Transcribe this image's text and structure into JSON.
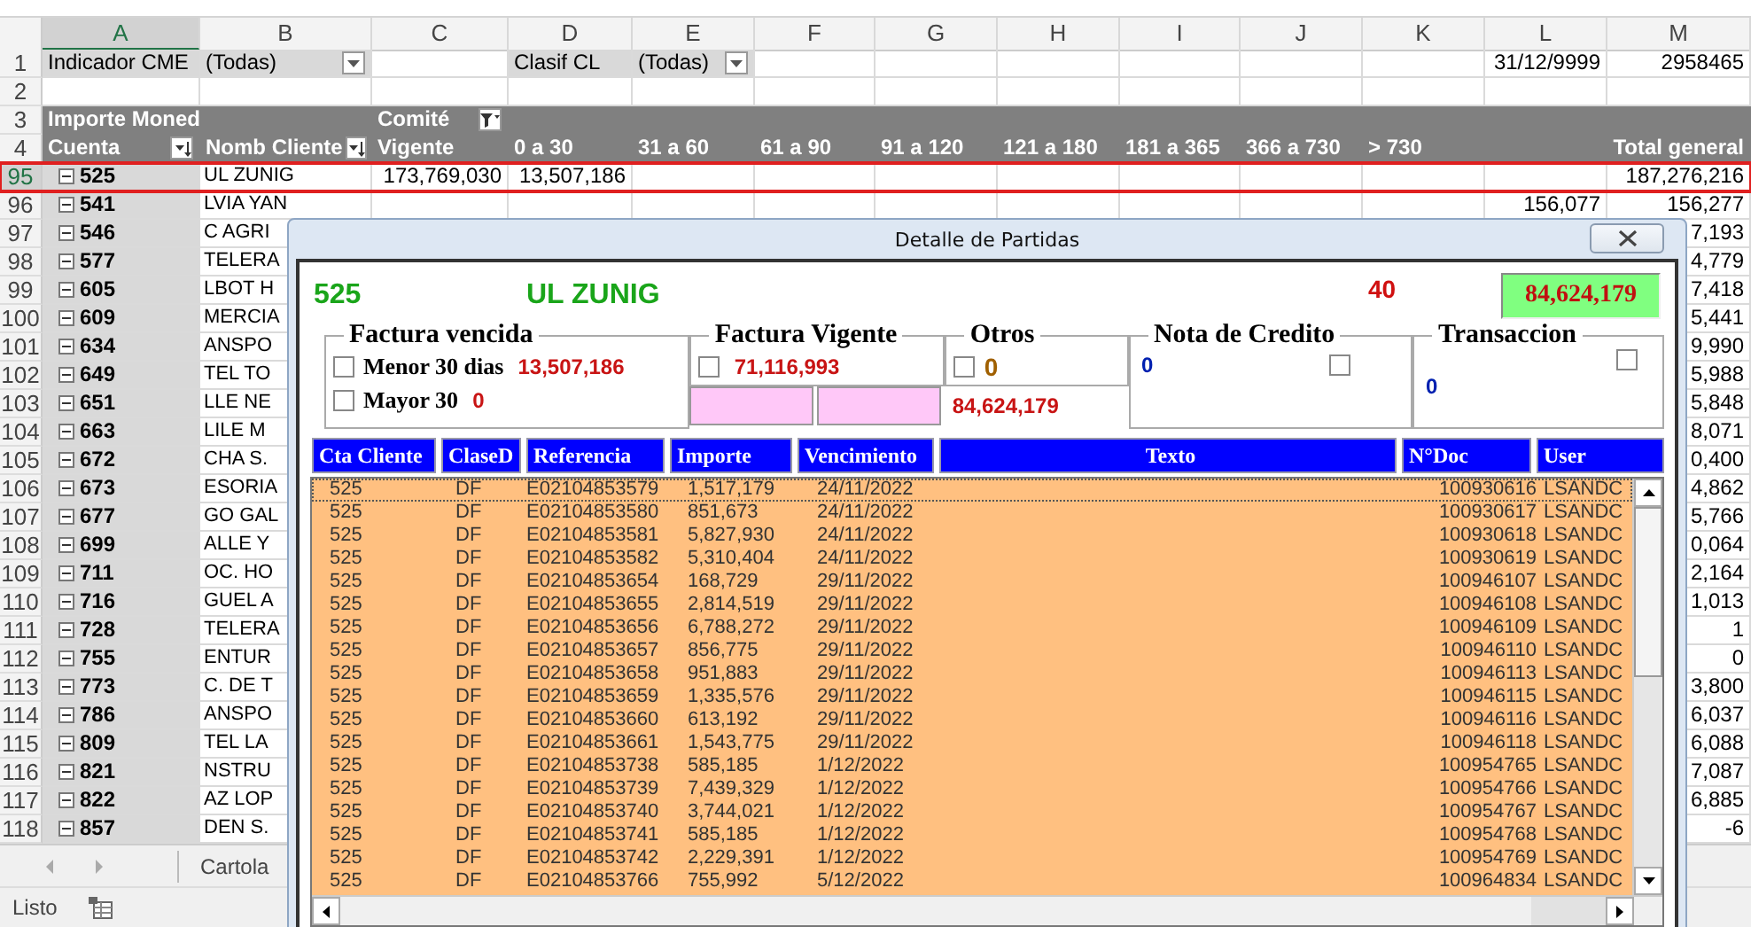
{
  "sheet": {
    "columns": [
      "A",
      "B",
      "C",
      "D",
      "E",
      "F",
      "G",
      "H",
      "I",
      "J",
      "K",
      "L",
      "M"
    ],
    "rows": [
      {
        "num": "1",
        "kind": "filter",
        "selected": false,
        "cells": {
          "A": {
            "text": "Indicador CME",
            "shaded": true
          },
          "B": {
            "text": "(Todas)",
            "shaded": true,
            "kind": "dropdown"
          },
          "D": {
            "text": "Clasif CL",
            "shaded": true
          },
          "E": {
            "text": "(Todas)",
            "shaded": true,
            "kind": "dropdown"
          },
          "L": {
            "text": "31/12/9999",
            "shaded": false
          },
          "M": {
            "text": "2958465",
            "shaded": false
          }
        }
      },
      {
        "num": "2",
        "kind": "blank",
        "selected": false
      },
      {
        "num": "3",
        "kind": "header",
        "selected": false,
        "cells": {
          "A": {
            "text": "Importe Moned"
          },
          "C": {
            "text": "Comité",
            "kind": "filter"
          }
        }
      },
      {
        "num": "4",
        "kind": "header",
        "selected": false,
        "cells": {
          "A": {
            "text": "Cuenta",
            "kind": "sort"
          },
          "B": {
            "text": "Nomb Cliente",
            "kind": "sort"
          },
          "C": {
            "text": "Vigente"
          },
          "D": {
            "text": "0 a 30"
          },
          "E": {
            "text": "31 a 60"
          },
          "F": {
            "text": "61 a 90"
          },
          "G": {
            "text": "91 a 120"
          },
          "H": {
            "text": "121 a 180"
          },
          "I": {
            "text": "181 a 365"
          },
          "J": {
            "text": "366 a 730"
          },
          "K": {
            "text": "> 730"
          },
          "M": {
            "text": "Total general"
          }
        }
      },
      {
        "num": "95",
        "kind": "data",
        "selected": true,
        "cells": {
          "A": {
            "text": "525"
          },
          "B": {
            "text": "UL ZUNIG"
          },
          "C": {
            "text": "173,769,030"
          },
          "D": {
            "text": "13,507,186"
          },
          "M": {
            "text": "187,276,216"
          }
        }
      },
      {
        "num": "96",
        "kind": "data",
        "selected": false,
        "cells": {
          "A": {
            "text": "541"
          },
          "B": {
            "text": "LVIA YAN"
          },
          "L": {
            "text": "156,077"
          },
          "M": {
            "text": "156,277"
          }
        }
      },
      {
        "num": "97",
        "kind": "data",
        "selected": false,
        "cells": {
          "A": {
            "text": "546"
          },
          "B": {
            "text": "C AGRI"
          },
          "M": {
            "text": "7,193"
          }
        }
      },
      {
        "num": "98",
        "kind": "data",
        "selected": false,
        "cells": {
          "A": {
            "text": "577"
          },
          "B": {
            "text": "TELERA"
          },
          "M": {
            "text": "4,779"
          }
        }
      },
      {
        "num": "99",
        "kind": "data",
        "selected": false,
        "cells": {
          "A": {
            "text": "605"
          },
          "B": {
            "text": "LBOT H"
          },
          "M": {
            "text": "7,418"
          }
        }
      },
      {
        "num": "100",
        "kind": "data",
        "selected": false,
        "cells": {
          "A": {
            "text": "609"
          },
          "B": {
            "text": "MERCIA"
          },
          "M": {
            "text": "5,441"
          }
        }
      },
      {
        "num": "101",
        "kind": "data",
        "selected": false,
        "cells": {
          "A": {
            "text": "634"
          },
          "B": {
            "text": "ANSPO"
          },
          "M": {
            "text": "9,990"
          }
        }
      },
      {
        "num": "102",
        "kind": "data",
        "selected": false,
        "cells": {
          "A": {
            "text": "649"
          },
          "B": {
            "text": "TEL TO"
          },
          "M": {
            "text": "5,988"
          }
        }
      },
      {
        "num": "103",
        "kind": "data",
        "selected": false,
        "cells": {
          "A": {
            "text": "651"
          },
          "B": {
            "text": "LLE NE"
          },
          "M": {
            "text": "5,848"
          }
        }
      },
      {
        "num": "104",
        "kind": "data",
        "selected": false,
        "cells": {
          "A": {
            "text": "663"
          },
          "B": {
            "text": "LILE M"
          },
          "M": {
            "text": "8,071"
          }
        }
      },
      {
        "num": "105",
        "kind": "data",
        "selected": false,
        "cells": {
          "A": {
            "text": "672"
          },
          "B": {
            "text": "CHA S."
          },
          "M": {
            "text": "0,400"
          }
        }
      },
      {
        "num": "106",
        "kind": "data",
        "selected": false,
        "cells": {
          "A": {
            "text": "673"
          },
          "B": {
            "text": "ESORIA"
          },
          "M": {
            "text": "4,862"
          }
        }
      },
      {
        "num": "107",
        "kind": "data",
        "selected": false,
        "cells": {
          "A": {
            "text": "677"
          },
          "B": {
            "text": "GO GAL"
          },
          "M": {
            "text": "5,766"
          }
        }
      },
      {
        "num": "108",
        "kind": "data",
        "selected": false,
        "cells": {
          "A": {
            "text": "699"
          },
          "B": {
            "text": "ALLE Y"
          },
          "M": {
            "text": "0,064"
          }
        }
      },
      {
        "num": "109",
        "kind": "data",
        "selected": false,
        "cells": {
          "A": {
            "text": "711"
          },
          "B": {
            "text": "OC. HO"
          },
          "M": {
            "text": "2,164"
          }
        }
      },
      {
        "num": "110",
        "kind": "data",
        "selected": false,
        "cells": {
          "A": {
            "text": "716"
          },
          "B": {
            "text": "GUEL A"
          },
          "M": {
            "text": "1,013"
          }
        }
      },
      {
        "num": "111",
        "kind": "data",
        "selected": false,
        "cells": {
          "A": {
            "text": "728"
          },
          "B": {
            "text": "TELERA"
          },
          "M": {
            "text": "1"
          }
        }
      },
      {
        "num": "112",
        "kind": "data",
        "selected": false,
        "cells": {
          "A": {
            "text": "755"
          },
          "B": {
            "text": "ENTUR"
          },
          "M": {
            "text": "0"
          }
        }
      },
      {
        "num": "113",
        "kind": "data",
        "selected": false,
        "cells": {
          "A": {
            "text": "773"
          },
          "B": {
            "text": "C. DE T"
          },
          "M": {
            "text": "3,800"
          }
        }
      },
      {
        "num": "114",
        "kind": "data",
        "selected": false,
        "cells": {
          "A": {
            "text": "786"
          },
          "B": {
            "text": "ANSPO"
          },
          "M": {
            "text": "6,037"
          }
        }
      },
      {
        "num": "115",
        "kind": "data",
        "selected": false,
        "cells": {
          "A": {
            "text": "809"
          },
          "B": {
            "text": "TEL LA"
          },
          "M": {
            "text": "6,088"
          }
        }
      },
      {
        "num": "116",
        "kind": "data",
        "selected": false,
        "cells": {
          "A": {
            "text": "821"
          },
          "B": {
            "text": "NSTRU"
          },
          "M": {
            "text": "7,087"
          }
        }
      },
      {
        "num": "117",
        "kind": "data",
        "selected": false,
        "cells": {
          "A": {
            "text": "822"
          },
          "B": {
            "text": "AZ LOP"
          },
          "M": {
            "text": "6,885"
          }
        }
      },
      {
        "num": "118",
        "kind": "data",
        "selected": false,
        "cells": {
          "A": {
            "text": "857"
          },
          "B": {
            "text": "DEN S."
          },
          "M": {
            "text": "-6"
          }
        }
      }
    ]
  },
  "sheet_tabs": [
    {
      "label": "Cartola"
    }
  ],
  "status_bar": {
    "text": "Listo"
  },
  "dialog": {
    "title": "Detalle de Partidas",
    "account": "525",
    "client": "UL ZUNIG",
    "count": "40",
    "total": "84,624,179",
    "groups": [
      {
        "kind": "vencida",
        "title": "Factura vencida",
        "options": [
          {
            "label": "Menor 30 dias",
            "checked": false,
            "value": "13,507,186"
          },
          {
            "label": "Mayor 30",
            "checked": false,
            "value": "0"
          }
        ]
      },
      {
        "kind": "vigente",
        "title": "Factura Vigente",
        "checked": false,
        "value": "71,116,993"
      },
      {
        "kind": "otros",
        "title": "Otros",
        "checked": false,
        "value": "0",
        "subtotal": "84,624,179"
      },
      {
        "kind": "nota",
        "title": "Nota de Credito",
        "checked": false,
        "value": "0"
      },
      {
        "kind": "transaccion",
        "title": "Transaccion",
        "checked": false,
        "value": "0"
      }
    ],
    "columns": [
      "Cta Cliente",
      "ClaseD",
      "Referencia",
      "Importe",
      "Vencimiento",
      "Texto",
      "N°Doc",
      "User"
    ],
    "rows": [
      {
        "cta": "525",
        "clase": "DF",
        "ref": "E02104853579",
        "importe": "1,517,179",
        "vencimiento": "24/11/2022",
        "doc": "100930616",
        "user": "LSANDC",
        "selected": true
      },
      {
        "cta": "525",
        "clase": "DF",
        "ref": "E02104853580",
        "importe": "851,673",
        "vencimiento": "24/11/2022",
        "doc": "100930617",
        "user": "LSANDC",
        "selected": false
      },
      {
        "cta": "525",
        "clase": "DF",
        "ref": "E02104853581",
        "importe": "5,827,930",
        "vencimiento": "24/11/2022",
        "doc": "100930618",
        "user": "LSANDC",
        "selected": false
      },
      {
        "cta": "525",
        "clase": "DF",
        "ref": "E02104853582",
        "importe": "5,310,404",
        "vencimiento": "24/11/2022",
        "doc": "100930619",
        "user": "LSANDC",
        "selected": false
      },
      {
        "cta": "525",
        "clase": "DF",
        "ref": "E02104853654",
        "importe": "168,729",
        "vencimiento": "29/11/2022",
        "doc": "100946107",
        "user": "LSANDC",
        "selected": false
      },
      {
        "cta": "525",
        "clase": "DF",
        "ref": "E02104853655",
        "importe": "2,814,519",
        "vencimiento": "29/11/2022",
        "doc": "100946108",
        "user": "LSANDC",
        "selected": false
      },
      {
        "cta": "525",
        "clase": "DF",
        "ref": "E02104853656",
        "importe": "6,788,272",
        "vencimiento": "29/11/2022",
        "doc": "100946109",
        "user": "LSANDC",
        "selected": false
      },
      {
        "cta": "525",
        "clase": "DF",
        "ref": "E02104853657",
        "importe": "856,775",
        "vencimiento": "29/11/2022",
        "doc": "100946110",
        "user": "LSANDC",
        "selected": false
      },
      {
        "cta": "525",
        "clase": "DF",
        "ref": "E02104853658",
        "importe": "951,883",
        "vencimiento": "29/11/2022",
        "doc": "100946113",
        "user": "LSANDC",
        "selected": false
      },
      {
        "cta": "525",
        "clase": "DF",
        "ref": "E02104853659",
        "importe": "1,335,576",
        "vencimiento": "29/11/2022",
        "doc": "100946115",
        "user": "LSANDC",
        "selected": false
      },
      {
        "cta": "525",
        "clase": "DF",
        "ref": "E02104853660",
        "importe": "613,192",
        "vencimiento": "29/11/2022",
        "doc": "100946116",
        "user": "LSANDC",
        "selected": false
      },
      {
        "cta": "525",
        "clase": "DF",
        "ref": "E02104853661",
        "importe": "1,543,775",
        "vencimiento": "29/11/2022",
        "doc": "100946118",
        "user": "LSANDC",
        "selected": false
      },
      {
        "cta": "525",
        "clase": "DF",
        "ref": "E02104853738",
        "importe": "585,185",
        "vencimiento": "1/12/2022",
        "doc": "100954765",
        "user": "LSANDC",
        "selected": false
      },
      {
        "cta": "525",
        "clase": "DF",
        "ref": "E02104853739",
        "importe": "7,439,329",
        "vencimiento": "1/12/2022",
        "doc": "100954766",
        "user": "LSANDC",
        "selected": false
      },
      {
        "cta": "525",
        "clase": "DF",
        "ref": "E02104853740",
        "importe": "3,744,021",
        "vencimiento": "1/12/2022",
        "doc": "100954767",
        "user": "LSANDC",
        "selected": false
      },
      {
        "cta": "525",
        "clase": "DF",
        "ref": "E02104853741",
        "importe": "585,185",
        "vencimiento": "1/12/2022",
        "doc": "100954768",
        "user": "LSANDC",
        "selected": false
      },
      {
        "cta": "525",
        "clase": "DF",
        "ref": "E02104853742",
        "importe": "2,229,391",
        "vencimiento": "1/12/2022",
        "doc": "100954769",
        "user": "LSANDC",
        "selected": false
      },
      {
        "cta": "525",
        "clase": "DF",
        "ref": "E02104853766",
        "importe": "755,992",
        "vencimiento": "5/12/2022",
        "doc": "100964834",
        "user": "LSANDC",
        "selected": false
      }
    ]
  }
}
